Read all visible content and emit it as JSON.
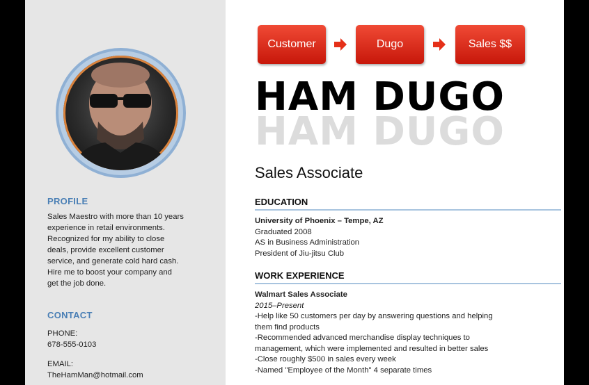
{
  "flow": {
    "steps": [
      "Customer",
      "Dugo",
      "Sales $$"
    ]
  },
  "header": {
    "name": "HAM DUGO",
    "title": "Sales Associate"
  },
  "profile": {
    "heading": "PROFILE",
    "lines": [
      "Sales Maestro with more than 10 years",
      "experience in retail environments.",
      "Recognized for my ability to close",
      "deals, provide excellent customer",
      "service, and generate cold hard cash.",
      "Hire me to boost your company and",
      "get the job done."
    ]
  },
  "contact": {
    "heading": "CONTACT",
    "phone_label": "PHONE:",
    "phone": "678-555-0103",
    "email_label": "EMAIL:",
    "email": "TheHamMan@hotmail.com"
  },
  "education": {
    "heading": "EDUCATION",
    "school": "University of Phoenix – Tempe, AZ",
    "lines": [
      "Graduated 2008",
      "AS in Business Administration",
      "President of Jiu-jitsu Club"
    ]
  },
  "work": {
    "heading": "WORK EXPERIENCE",
    "role": "Walmart Sales Associate",
    "dates": "2015–Present",
    "lines": [
      "-Help like 50 customers per day by answering questions and helping",
      "them find products",
      "-Recommended advanced merchandise display techniques to",
      "management, which were implemented and resulted in better sales",
      "-Close roughly $500 in sales every week",
      "-Named \"Employee of the Month\" 4 separate times"
    ]
  },
  "colors": {
    "accent_blue": "#4a7fb5",
    "flow_red": "#e02a18",
    "sidebar_bg": "#e6e6e6"
  }
}
